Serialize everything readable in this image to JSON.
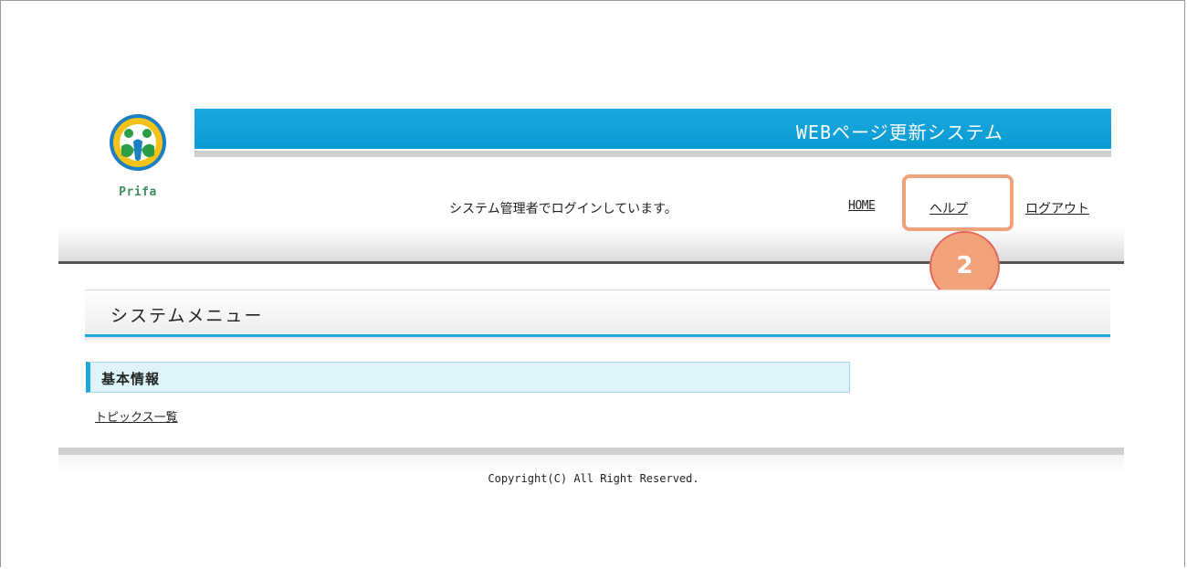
{
  "logo": {
    "text": "Prifa",
    "icon": "prifa-logo-icon"
  },
  "header": {
    "title": "WEBページ更新システム",
    "title_bar_color": "#0a9ad3"
  },
  "status": {
    "login_message": "システム管理者でログインしています。"
  },
  "nav": {
    "home": "HOME",
    "help": "ヘルプ",
    "logout": "ログアウト"
  },
  "annotation": {
    "step_number": "2",
    "highlight_color": "#f0a37a"
  },
  "menu": {
    "title": "システムメニュー",
    "sections": [
      {
        "heading": "基本情報",
        "links": [
          "トピックス一覧"
        ]
      }
    ]
  },
  "footer": {
    "copyright": "Copyright(C) All Right Reserved."
  }
}
